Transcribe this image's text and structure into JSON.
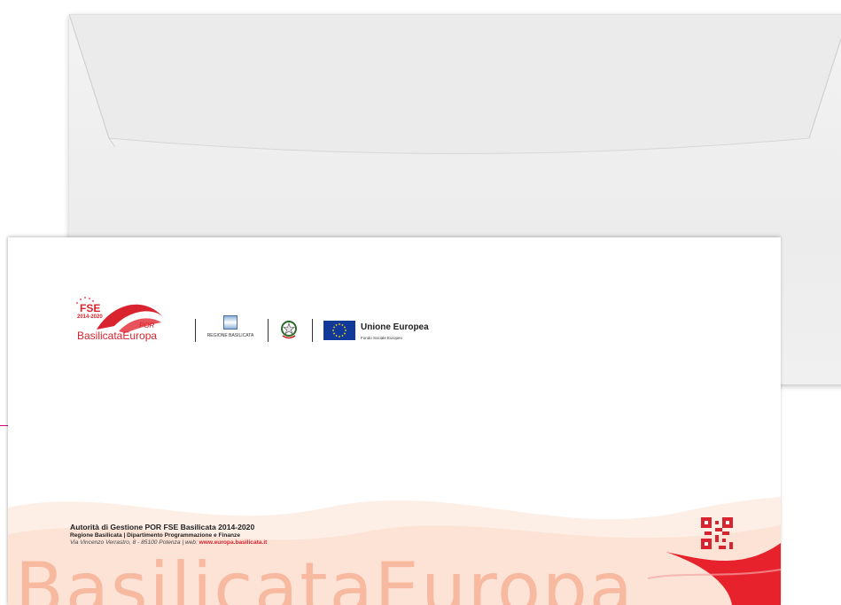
{
  "logos": {
    "fse_label": "FSE",
    "fse_years": "2014-2020",
    "por_label": "POR",
    "fse_brand": "BasilicataEuropa",
    "regione_label": "REGIONE BASILICATA",
    "eu_title": "Unione Europea",
    "eu_subtitle": "Fondo Sociale Europeo"
  },
  "footer": {
    "title": "Autorità di Gestione POR FSE Basilicata 2014-2020",
    "department": "Regione Basilicata | Dipartimento Programmazione e Finanze",
    "address_prefix": "Via Vincenzo Verrastro, 8 - 85100 Potenza | web:",
    "website": "www.europa.basilicata.it"
  },
  "watermark": "BasilicataEuropa",
  "colors": {
    "brand_red": "#d9232e",
    "marker_magenta": "#d10082",
    "eu_blue": "#10399a",
    "eu_star": "#ffdd00",
    "wave_peach": "#fde3d6"
  },
  "icons": {
    "fse": "fse-logo-icon",
    "regione": "regione-basilicata-icon",
    "emblem": "italian-republic-emblem-icon",
    "eu": "eu-flag-icon",
    "qr": "qr-code-icon"
  }
}
